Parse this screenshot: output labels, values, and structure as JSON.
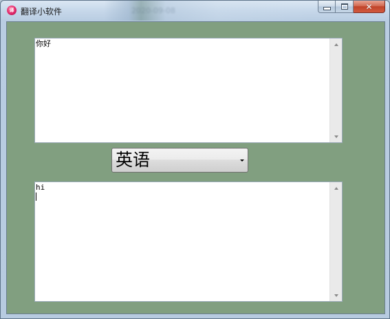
{
  "window": {
    "title": "翻译小软件",
    "icon": "translate-app-icon",
    "icon_glyph": "译",
    "background_color": "#819f80",
    "background_blur_text": "2020-09-08",
    "buttons": {
      "minimize": "minimize-icon",
      "maximize": "maximize-icon",
      "close": "close-icon",
      "close_glyph": "✕"
    }
  },
  "source_text": {
    "value": "你好"
  },
  "language_select": {
    "selected": "英语",
    "options": [
      "英语"
    ]
  },
  "result_text": {
    "value": "hi"
  }
}
